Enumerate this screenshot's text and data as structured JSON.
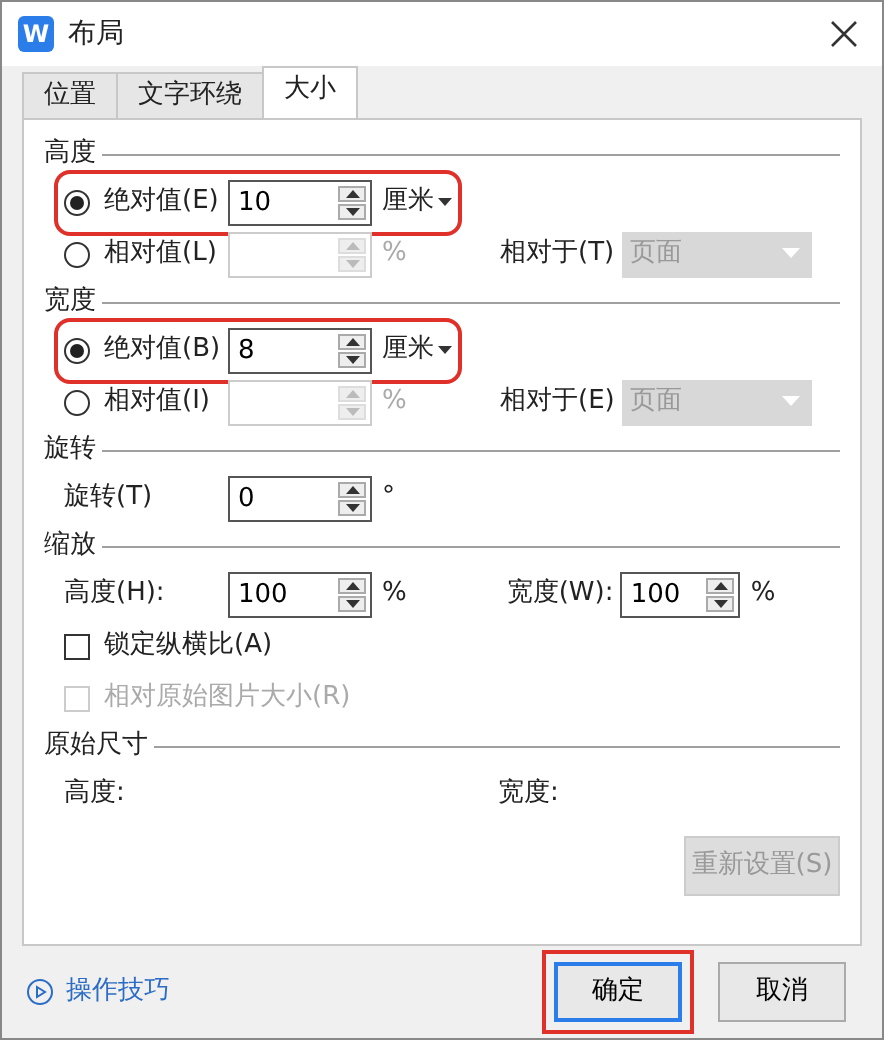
{
  "window": {
    "title": "布局",
    "icon_letter": "W"
  },
  "tabs": [
    {
      "label": "位置",
      "selected": false
    },
    {
      "label": "文字环绕",
      "selected": false
    },
    {
      "label": "大小",
      "selected": true
    }
  ],
  "sections": [
    {
      "title": "高度",
      "rows": [
        {
          "kind": "radio",
          "label": "绝对值(E)",
          "selected": true,
          "disabled": false,
          "value": "10",
          "unit": "厘米",
          "unit_dropdown": true,
          "highlighted": true
        },
        {
          "kind": "radio",
          "label": "相对值(L)",
          "selected": false,
          "disabled": true,
          "unit": "%",
          "relative_label": "相对于(T)",
          "relative_value": "页面"
        }
      ]
    },
    {
      "title": "宽度",
      "rows": [
        {
          "kind": "radio",
          "label": "绝对值(B)",
          "selected": true,
          "disabled": false,
          "value": "8",
          "unit": "厘米",
          "unit_dropdown": true,
          "highlighted": true
        },
        {
          "kind": "radio",
          "label": "相对值(I)",
          "selected": false,
          "disabled": true,
          "unit": "%",
          "relative_label": "相对于(E)",
          "relative_value": "页面"
        }
      ]
    },
    {
      "title": "旋转",
      "rows": [
        {
          "kind": "spin",
          "label": "旋转(T)",
          "value": "0",
          "unit": "°"
        }
      ]
    },
    {
      "title": "缩放",
      "rows": [
        {
          "kind": "spin",
          "label": "高度(H):",
          "value": "100",
          "unit": "%",
          "label2": "宽度(W):",
          "value2": "100",
          "unit2": "%"
        },
        {
          "kind": "checkbox",
          "label": "锁定纵横比(A)",
          "checked": false,
          "disabled": false
        },
        {
          "kind": "checkbox",
          "label": "相对原始图片大小(R)",
          "checked": false,
          "disabled": true
        }
      ]
    },
    {
      "title": "原始尺寸",
      "rows": [
        {
          "kind": "info",
          "label": "高度:",
          "label2": "宽度:"
        }
      ]
    }
  ],
  "reset_button": {
    "label": "重新设置(S)",
    "disabled": true
  },
  "help_link": "操作技巧",
  "buttons": [
    {
      "label": "确定",
      "highlighted": true
    },
    {
      "label": "取消",
      "highlighted": false
    }
  ]
}
